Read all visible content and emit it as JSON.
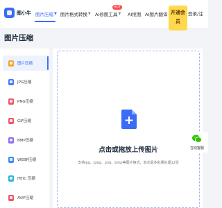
{
  "header": {
    "logo_text": "图小牛",
    "nav": [
      {
        "label": "图片压缩",
        "has_menu": true
      },
      {
        "label": "图片格式转换",
        "has_menu": true
      },
      {
        "label": "AI修图工具",
        "has_menu": true,
        "badge": "HOT"
      },
      {
        "label": "AI抠图",
        "has_menu": false
      },
      {
        "label": "AI图片翻译",
        "has_menu": false
      }
    ],
    "vip_label": "开通会员",
    "login_label": "登录/注"
  },
  "page": {
    "title": "图片压缩"
  },
  "sidebar": {
    "items": [
      {
        "label": "图片压缩",
        "icon": "image-icon",
        "color": "#f5a623",
        "active": true
      },
      {
        "label": "JPG压缩",
        "icon": "jpg-icon",
        "color": "#4a7cf7",
        "active": false
      },
      {
        "label": "PNG压缩",
        "icon": "png-icon",
        "color": "#f0566b",
        "active": false
      },
      {
        "label": "GIF压缩",
        "icon": "gif-icon",
        "color": "#f0566b",
        "active": false
      },
      {
        "label": "BMP压缩",
        "icon": "bmp-icon",
        "color": "#8d6cf0",
        "active": false
      },
      {
        "label": "WEBP压缩",
        "icon": "webp-icon",
        "color": "#3b8cf6",
        "active": false
      },
      {
        "label": "HEIC 压缩",
        "icon": "heic-icon",
        "color": "#2fb6d6",
        "active": false
      },
      {
        "label": "AVIF压缩",
        "icon": "avif-icon",
        "color": "#f0566b",
        "active": false
      }
    ]
  },
  "upload": {
    "icon": "document-plus-icon",
    "title": "点击或拖放上传图片",
    "hint": "支持jpg、jpeg、png、bmp等图片格式，单次最多批量处理12张"
  },
  "service": {
    "icon": "wechat-icon",
    "label": "在线客服"
  },
  "colors": {
    "accent": "#3b6cf6",
    "vip": "#ffd84d",
    "badge": "#ff4d4f"
  }
}
